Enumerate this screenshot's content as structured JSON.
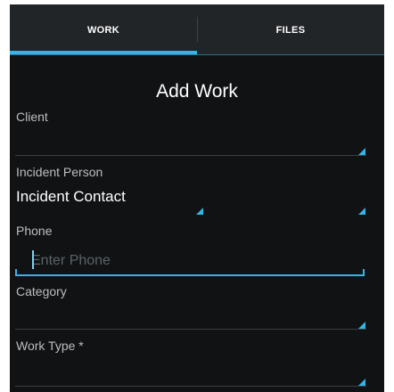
{
  "tabs": [
    {
      "label": "WORK",
      "selected": true
    },
    {
      "label": "FILES",
      "selected": false
    }
  ],
  "form": {
    "title": "Add Work",
    "client": {
      "label": "Client",
      "value": ""
    },
    "incident_person": {
      "label": "Incident Person",
      "value": "Incident Contact",
      "second_value": ""
    },
    "phone": {
      "label": "Phone",
      "value": "",
      "placeholder": "Enter Phone"
    },
    "category": {
      "label": "Category",
      "value": ""
    },
    "work_type": {
      "label": "Work Type *",
      "value": ""
    }
  },
  "colors": {
    "accent": "#33b5e5",
    "background": "#111214",
    "tab_bar": "#222528"
  }
}
